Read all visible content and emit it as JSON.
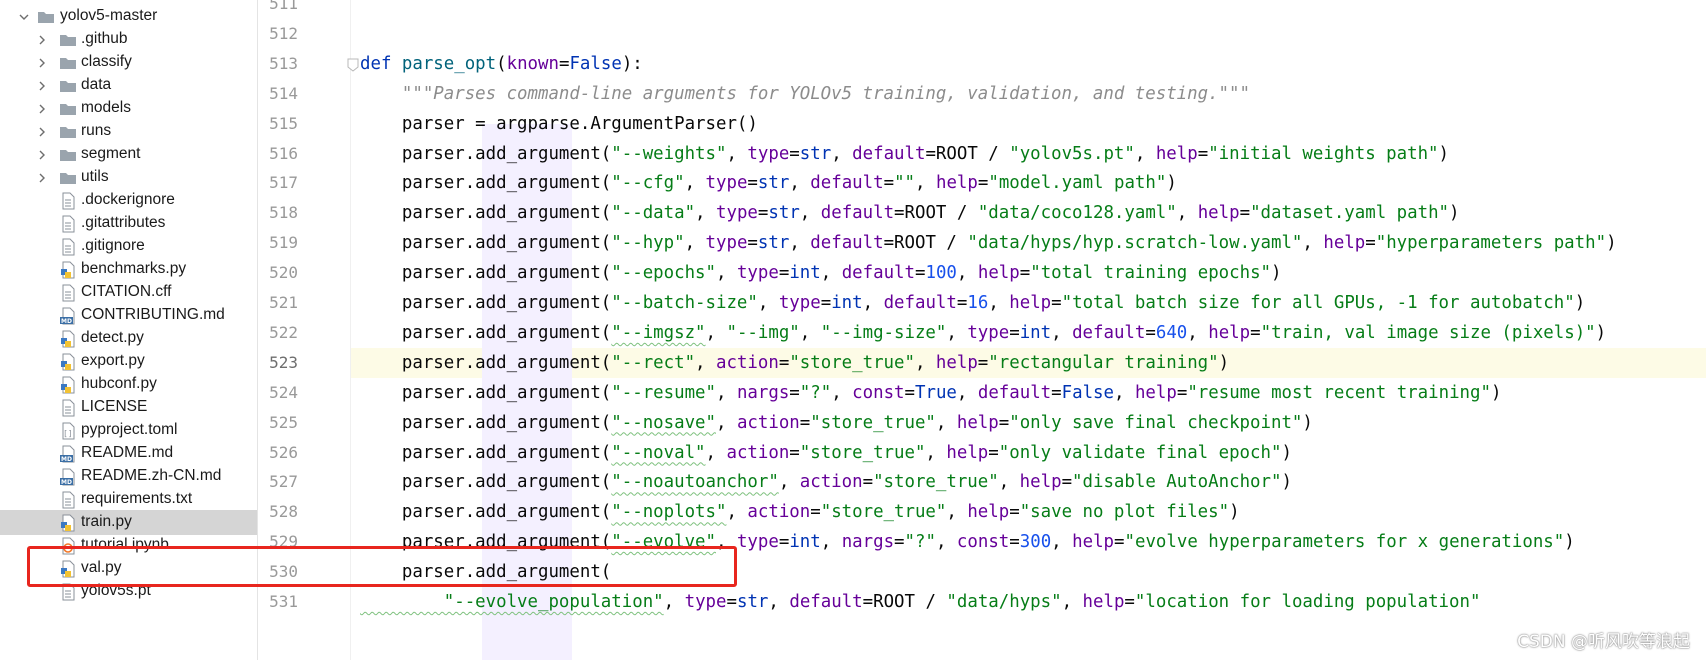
{
  "project_tree": {
    "root": "yolov5-master",
    "items": [
      {
        "label": ".github",
        "kind": "folder"
      },
      {
        "label": "classify",
        "kind": "folder"
      },
      {
        "label": "data",
        "kind": "folder"
      },
      {
        "label": "models",
        "kind": "folder"
      },
      {
        "label": "runs",
        "kind": "folder"
      },
      {
        "label": "segment",
        "kind": "folder"
      },
      {
        "label": "utils",
        "kind": "folder"
      },
      {
        "label": ".dockerignore",
        "kind": "text-file"
      },
      {
        "label": ".gitattributes",
        "kind": "text-file"
      },
      {
        "label": ".gitignore",
        "kind": "text-file"
      },
      {
        "label": "benchmarks.py",
        "kind": "python-file"
      },
      {
        "label": "CITATION.cff",
        "kind": "text-file"
      },
      {
        "label": "CONTRIBUTING.md",
        "kind": "markdown-file"
      },
      {
        "label": "detect.py",
        "kind": "python-file"
      },
      {
        "label": "export.py",
        "kind": "python-file"
      },
      {
        "label": "hubconf.py",
        "kind": "python-file"
      },
      {
        "label": "LICENSE",
        "kind": "text-file"
      },
      {
        "label": "pyproject.toml",
        "kind": "toml-file"
      },
      {
        "label": "README.md",
        "kind": "markdown-file"
      },
      {
        "label": "README.zh-CN.md",
        "kind": "markdown-file"
      },
      {
        "label": "requirements.txt",
        "kind": "text-file"
      },
      {
        "label": "train.py",
        "kind": "python-file",
        "selected": true
      },
      {
        "label": "tutorial.ipynb",
        "kind": "notebook-file"
      },
      {
        "label": "val.py",
        "kind": "python-file"
      },
      {
        "label": "yolov5s.pt",
        "kind": "text-file"
      }
    ]
  },
  "editor": {
    "line_numbers": [
      "511",
      "512",
      "513",
      "514",
      "515",
      "516",
      "517",
      "518",
      "519",
      "520",
      "521",
      "522",
      "523",
      "524",
      "525",
      "526",
      "527",
      "528",
      "529",
      "530",
      "531"
    ],
    "current_line": "523",
    "lines": [
      [],
      [],
      [
        [
          "kw",
          "def "
        ],
        [
          "fn",
          "parse_opt"
        ],
        [
          "plain",
          "("
        ],
        [
          "kwarg",
          "known"
        ],
        [
          "plain",
          "="
        ],
        [
          "kw",
          "False"
        ],
        [
          "plain",
          "):"
        ]
      ],
      [
        [
          "doc",
          "    \"\"\"Parses command-line arguments for YOLOv5 training, validation, and testing.\"\"\""
        ]
      ],
      [
        [
          "plain",
          "    parser = argparse.ArgumentParser()"
        ]
      ],
      [
        [
          "plain",
          "    parser.add_argument("
        ],
        [
          "str",
          "\"--weights\""
        ],
        [
          "plain",
          ", "
        ],
        [
          "kwarg",
          "type"
        ],
        [
          "plain",
          "="
        ],
        [
          "kw",
          "str"
        ],
        [
          "plain",
          ", "
        ],
        [
          "kwarg",
          "default"
        ],
        [
          "plain",
          "=ROOT / "
        ],
        [
          "str",
          "\"yolov5s.pt\""
        ],
        [
          "plain",
          ", "
        ],
        [
          "kwarg",
          "help"
        ],
        [
          "plain",
          "="
        ],
        [
          "str",
          "\"initial weights path\""
        ],
        [
          "plain",
          ")"
        ]
      ],
      [
        [
          "plain",
          "    parser.add_argument("
        ],
        [
          "str",
          "\"--cfg\""
        ],
        [
          "plain",
          ", "
        ],
        [
          "kwarg",
          "type"
        ],
        [
          "plain",
          "="
        ],
        [
          "kw",
          "str"
        ],
        [
          "plain",
          ", "
        ],
        [
          "kwarg",
          "default"
        ],
        [
          "plain",
          "="
        ],
        [
          "str",
          "\"\""
        ],
        [
          "plain",
          ", "
        ],
        [
          "kwarg",
          "help"
        ],
        [
          "plain",
          "="
        ],
        [
          "str",
          "\"model.yaml path\""
        ],
        [
          "plain",
          ")"
        ]
      ],
      [
        [
          "plain",
          "    parser.add_argument("
        ],
        [
          "str",
          "\"--data\""
        ],
        [
          "plain",
          ", "
        ],
        [
          "kwarg",
          "type"
        ],
        [
          "plain",
          "="
        ],
        [
          "kw",
          "str"
        ],
        [
          "plain",
          ", "
        ],
        [
          "kwarg",
          "default"
        ],
        [
          "plain",
          "=ROOT / "
        ],
        [
          "str",
          "\"data/coco128.yaml\""
        ],
        [
          "plain",
          ", "
        ],
        [
          "kwarg",
          "help"
        ],
        [
          "plain",
          "="
        ],
        [
          "str",
          "\"dataset.yaml path\""
        ],
        [
          "plain",
          ")"
        ]
      ],
      [
        [
          "plain",
          "    parser.add_argument("
        ],
        [
          "str",
          "\"--hyp\""
        ],
        [
          "plain",
          ", "
        ],
        [
          "kwarg",
          "type"
        ],
        [
          "plain",
          "="
        ],
        [
          "kw",
          "str"
        ],
        [
          "plain",
          ", "
        ],
        [
          "kwarg",
          "default"
        ],
        [
          "plain",
          "=ROOT / "
        ],
        [
          "str",
          "\"data/hyps/hyp.scratch-low.yaml\""
        ],
        [
          "plain",
          ", "
        ],
        [
          "kwarg",
          "help"
        ],
        [
          "plain",
          "="
        ],
        [
          "str",
          "\"hyperparameters path\""
        ],
        [
          "plain",
          ")"
        ]
      ],
      [
        [
          "plain",
          "    parser.add_argument("
        ],
        [
          "str",
          "\"--epochs\""
        ],
        [
          "plain",
          ", "
        ],
        [
          "kwarg",
          "type"
        ],
        [
          "plain",
          "="
        ],
        [
          "kw",
          "int"
        ],
        [
          "plain",
          ", "
        ],
        [
          "kwarg",
          "default"
        ],
        [
          "plain",
          "="
        ],
        [
          "num",
          "100"
        ],
        [
          "plain",
          ", "
        ],
        [
          "kwarg",
          "help"
        ],
        [
          "plain",
          "="
        ],
        [
          "str",
          "\"total training epochs\""
        ],
        [
          "plain",
          ")"
        ]
      ],
      [
        [
          "plain",
          "    parser.add_argument("
        ],
        [
          "str",
          "\"--batch-size\""
        ],
        [
          "plain",
          ", "
        ],
        [
          "kwarg",
          "type"
        ],
        [
          "plain",
          "="
        ],
        [
          "kw",
          "int"
        ],
        [
          "plain",
          ", "
        ],
        [
          "kwarg",
          "default"
        ],
        [
          "plain",
          "="
        ],
        [
          "num",
          "16"
        ],
        [
          "plain",
          ", "
        ],
        [
          "kwarg",
          "help"
        ],
        [
          "plain",
          "="
        ],
        [
          "str",
          "\"total batch size for all GPUs, -1 for autobatch\""
        ],
        [
          "plain",
          ")"
        ]
      ],
      [
        [
          "plain",
          "    parser.add_argument("
        ],
        [
          "str",
          "\"--imgsz\""
        ],
        [
          "plain",
          ", "
        ],
        [
          "str",
          "\"--img\""
        ],
        [
          "plain",
          ", "
        ],
        [
          "str",
          "\"--img-size\""
        ],
        [
          "plain",
          ", "
        ],
        [
          "kwarg",
          "type"
        ],
        [
          "plain",
          "="
        ],
        [
          "kw",
          "int"
        ],
        [
          "plain",
          ", "
        ],
        [
          "kwarg",
          "default"
        ],
        [
          "plain",
          "="
        ],
        [
          "num",
          "640"
        ],
        [
          "plain",
          ", "
        ],
        [
          "kwarg",
          "help"
        ],
        [
          "plain",
          "="
        ],
        [
          "str",
          "\"train, val image size (pixels)\""
        ],
        [
          "plain",
          ")"
        ]
      ],
      [
        [
          "plain",
          "    parser.add_argument("
        ],
        [
          "str",
          "\"--rect\""
        ],
        [
          "plain",
          ", "
        ],
        [
          "kwarg",
          "action"
        ],
        [
          "plain",
          "="
        ],
        [
          "str",
          "\"store_true\""
        ],
        [
          "plain",
          ", "
        ],
        [
          "kwarg",
          "help"
        ],
        [
          "plain",
          "="
        ],
        [
          "str",
          "\"rectangular training\""
        ],
        [
          "plain",
          ")"
        ]
      ],
      [
        [
          "plain",
          "    parser.add_argument("
        ],
        [
          "str",
          "\"--resume\""
        ],
        [
          "plain",
          ", "
        ],
        [
          "kwarg",
          "nargs"
        ],
        [
          "plain",
          "="
        ],
        [
          "str",
          "\"?\""
        ],
        [
          "plain",
          ", "
        ],
        [
          "kwarg",
          "const"
        ],
        [
          "plain",
          "="
        ],
        [
          "kw",
          "True"
        ],
        [
          "plain",
          ", "
        ],
        [
          "kwarg",
          "default"
        ],
        [
          "plain",
          "="
        ],
        [
          "kw",
          "False"
        ],
        [
          "plain",
          ", "
        ],
        [
          "kwarg",
          "help"
        ],
        [
          "plain",
          "="
        ],
        [
          "str",
          "\"resume most recent training\""
        ],
        [
          "plain",
          ")"
        ]
      ],
      [
        [
          "plain",
          "    parser.add_argument("
        ],
        [
          "str",
          "\"--nosave\""
        ],
        [
          "plain",
          ", "
        ],
        [
          "kwarg",
          "action"
        ],
        [
          "plain",
          "="
        ],
        [
          "str",
          "\"store_true\""
        ],
        [
          "plain",
          ", "
        ],
        [
          "kwarg",
          "help"
        ],
        [
          "plain",
          "="
        ],
        [
          "str",
          "\"only save final checkpoint\""
        ],
        [
          "plain",
          ")"
        ]
      ],
      [
        [
          "plain",
          "    parser.add_argument("
        ],
        [
          "str",
          "\"--noval\""
        ],
        [
          "plain",
          ", "
        ],
        [
          "kwarg",
          "action"
        ],
        [
          "plain",
          "="
        ],
        [
          "str",
          "\"store_true\""
        ],
        [
          "plain",
          ", "
        ],
        [
          "kwarg",
          "help"
        ],
        [
          "plain",
          "="
        ],
        [
          "str",
          "\"only validate final epoch\""
        ],
        [
          "plain",
          ")"
        ]
      ],
      [
        [
          "plain",
          "    parser.add_argument("
        ],
        [
          "str",
          "\"--noautoanchor\""
        ],
        [
          "plain",
          ", "
        ],
        [
          "kwarg",
          "action"
        ],
        [
          "plain",
          "="
        ],
        [
          "str",
          "\"store_true\""
        ],
        [
          "plain",
          ", "
        ],
        [
          "kwarg",
          "help"
        ],
        [
          "plain",
          "="
        ],
        [
          "str",
          "\"disable AutoAnchor\""
        ],
        [
          "plain",
          ")"
        ]
      ],
      [
        [
          "plain",
          "    parser.add_argument("
        ],
        [
          "str",
          "\"--noplots\""
        ],
        [
          "plain",
          ", "
        ],
        [
          "kwarg",
          "action"
        ],
        [
          "plain",
          "="
        ],
        [
          "str",
          "\"store_true\""
        ],
        [
          "plain",
          ", "
        ],
        [
          "kwarg",
          "help"
        ],
        [
          "plain",
          "="
        ],
        [
          "str",
          "\"save no plot files\""
        ],
        [
          "plain",
          ")"
        ]
      ],
      [
        [
          "plain",
          "    parser.add_argument("
        ],
        [
          "str",
          "\"--evolve\""
        ],
        [
          "plain",
          ", "
        ],
        [
          "kwarg",
          "type"
        ],
        [
          "plain",
          "="
        ],
        [
          "kw",
          "int"
        ],
        [
          "plain",
          ", "
        ],
        [
          "kwarg",
          "nargs"
        ],
        [
          "plain",
          "="
        ],
        [
          "str",
          "\"?\""
        ],
        [
          "plain",
          ", "
        ],
        [
          "kwarg",
          "const"
        ],
        [
          "plain",
          "="
        ],
        [
          "num",
          "300"
        ],
        [
          "plain",
          ", "
        ],
        [
          "kwarg",
          "help"
        ],
        [
          "plain",
          "="
        ],
        [
          "str",
          "\"evolve hyperparameters for x generations\""
        ],
        [
          "plain",
          ")"
        ]
      ],
      [
        [
          "plain",
          "    parser.add_argument("
        ]
      ],
      [
        [
          "str",
          "        \"--evolve_population\""
        ],
        [
          "plain",
          ", "
        ],
        [
          "kwarg",
          "type"
        ],
        [
          "plain",
          "="
        ],
        [
          "kw",
          "str"
        ],
        [
          "plain",
          ", "
        ],
        [
          "kwarg",
          "default"
        ],
        [
          "plain",
          "=ROOT / "
        ],
        [
          "str",
          "\"data/hyps\""
        ],
        [
          "plain",
          ", "
        ],
        [
          "kwarg",
          "help"
        ],
        [
          "plain",
          "="
        ],
        [
          "str",
          "\"location for loading population\""
        ]
      ]
    ]
  },
  "watermark": "CSDN @听风吹等浪起",
  "colors": {
    "keyword": "#0033b3",
    "function": "#00627a",
    "string": "#067d17",
    "number": "#1750eb",
    "kwarg": "#660099",
    "docstring": "#8c8c8c",
    "highlight": "#e8261e",
    "selection": "#d5d5d5"
  }
}
